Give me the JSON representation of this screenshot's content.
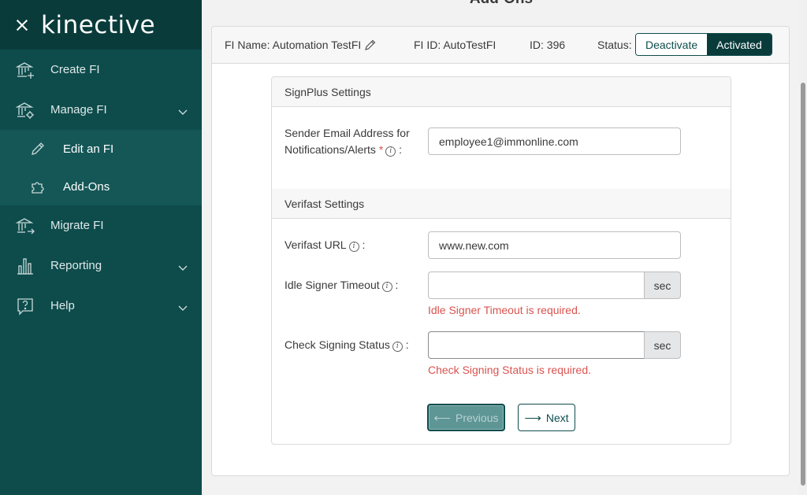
{
  "sidebar": {
    "brand": "kinective",
    "items": [
      {
        "label": "Create FI",
        "icon": "bank-plus-icon"
      },
      {
        "label": "Manage FI",
        "icon": "bank-gear-icon"
      },
      {
        "label": "Migrate FI",
        "icon": "bank-arrow-icon"
      },
      {
        "label": "Reporting",
        "icon": "bar-chart-icon"
      },
      {
        "label": "Help",
        "icon": "question-bubble-icon"
      }
    ],
    "sub_items": [
      {
        "label": "Edit an FI",
        "icon": "pencil-icon"
      },
      {
        "label": "Add-Ons",
        "icon": "puzzle-icon"
      }
    ]
  },
  "page": {
    "title": "Add-Ons"
  },
  "fi_bar": {
    "name": "FI Name: Automation TestFI",
    "fi_id": "FI ID: AutoTestFI",
    "id": "ID: 396",
    "status_label": "Status:",
    "deactivate": "Deactivate",
    "activated": "Activated"
  },
  "signplus": {
    "heading": "SignPlus Settings",
    "email_label_1": "Sender Email Address for",
    "email_label_2": "Notifications/Alerts",
    "required_mark": "*",
    "colon": ":",
    "email_value": "employee1@immonline.com"
  },
  "verifast": {
    "heading": "Verifast Settings",
    "url_label": "Verifast URL",
    "url_value": "www.new.com",
    "idle_label": "Idle Signer Timeout",
    "idle_unit": "sec",
    "idle_error": "Idle Signer Timeout is required.",
    "check_label": "Check Signing Status",
    "check_unit": "sec",
    "check_error": "Check Signing Status is required.",
    "colon": ":"
  },
  "buttons": {
    "previous": "Previous",
    "next": "Next"
  },
  "colors": {
    "sidebar": "#0e4c4c",
    "accent": "#0a3b3b",
    "error": "#d9534f"
  }
}
